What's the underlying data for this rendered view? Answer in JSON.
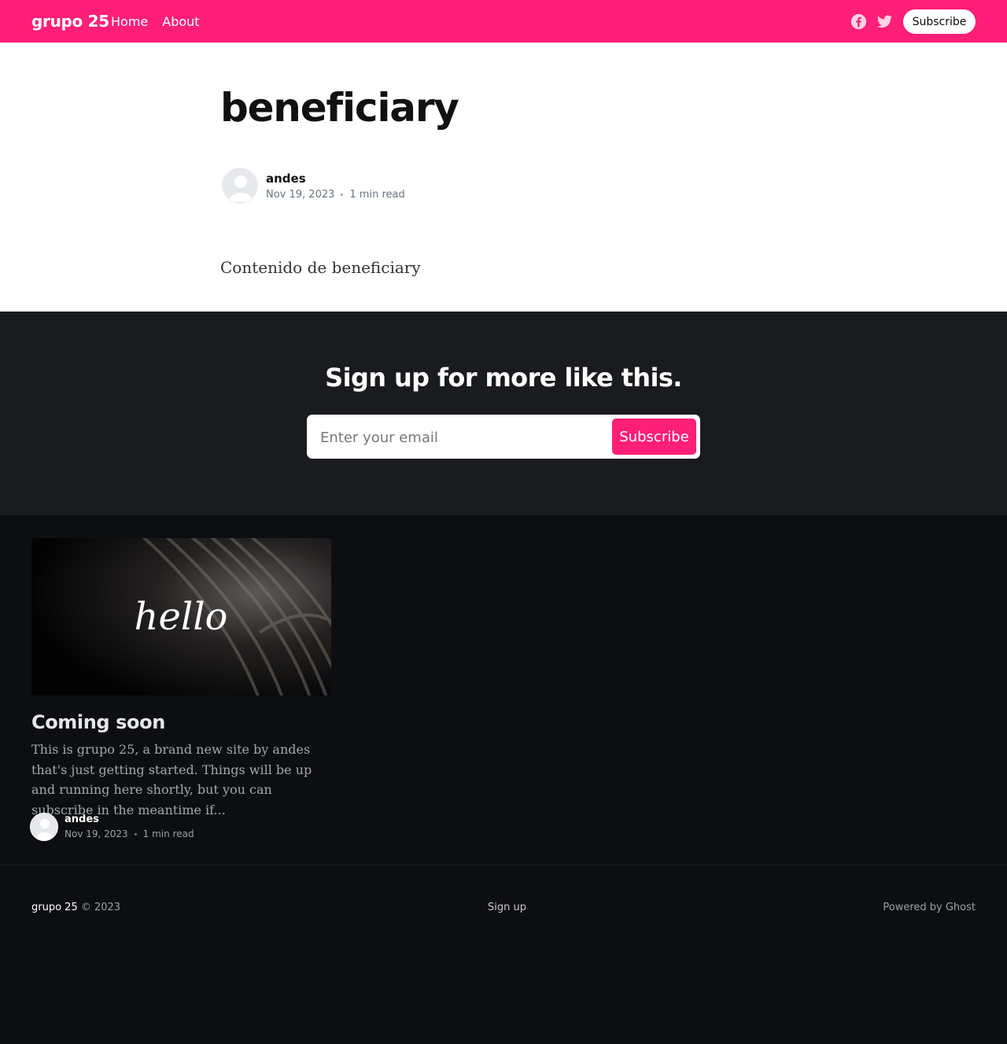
{
  "header": {
    "brand": "grupo 25",
    "nav": [
      "Home",
      "About"
    ],
    "subscribe_label": "Subscribe",
    "social_icons": [
      "facebook-icon",
      "twitter-icon"
    ],
    "accent_color": "#ff1f78"
  },
  "article": {
    "title": "beneficiary",
    "author": "andes",
    "date": "Nov 19, 2023",
    "read_time": "1 min read",
    "content": "Contenido de beneficiary"
  },
  "signup": {
    "title": "Sign up for more like this.",
    "email_placeholder": "Enter your email",
    "button_label": "Subscribe"
  },
  "related": {
    "image_text": "hello",
    "title": "Coming soon",
    "excerpt": "This is grupo 25, a brand new site by andes that's just getting started. Things will be up and running here shortly, but you can subscribe in the meantime if...",
    "author": "andes",
    "date": "Nov 19, 2023",
    "read_time": "1 min read"
  },
  "footer": {
    "site": "grupo 25",
    "copyright": "© 2023",
    "signup_label": "Sign up",
    "powered_by": "Powered by Ghost"
  }
}
